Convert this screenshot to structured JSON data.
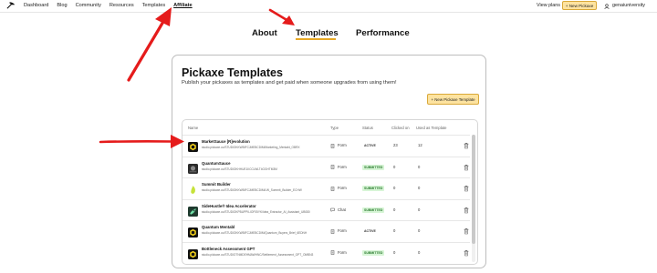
{
  "topnav": {
    "links": [
      "Dashboard",
      "Blog",
      "Community",
      "Resources",
      "Templates",
      "Affiliate"
    ],
    "active": "Affiliate",
    "view_plans": "View plans",
    "new_pickaxe": "+ New Pickaxe",
    "username": "genaiuniversity"
  },
  "tabs": [
    "About",
    "Templates",
    "Performance"
  ],
  "active_tab": "Templates",
  "card": {
    "title": "Pickaxe Templates",
    "subtitle": "Publish your pickaxes as templates and get paid when someone upgrades from using them!",
    "new_template_button": "+ New Pickaxe Template"
  },
  "table": {
    "headers": [
      "Name",
      "Type",
      "Status",
      "Clicked on",
      "Used as Template"
    ],
    "rows": [
      {
        "name": "MarketSauce [R]evolution",
        "url": "studio.pickaxe.co/STUDIOKKWBIFCJMEBCDIM/Marketing_Mentabt_OBRX",
        "type": "Form",
        "status": "ACTIVE",
        "clicked": "23",
        "used": "12",
        "avatar_icon": "hexagon-icon",
        "avatar_color": "#111111"
      },
      {
        "name": "QuantumSauce",
        "url": "studio.pickaxe.co/STUDIOKHHUE1IICCLWLT4GGHTM3M",
        "type": "Form",
        "status": "SUBMITTED",
        "clicked": "0",
        "used": "0",
        "avatar_icon": "photo-icon",
        "avatar_color": "#2b2b2b"
      },
      {
        "name": "Summit Builder",
        "url": "studio.pickaxe.co/STUDIOKKWBIFCJMEBCDIM/LW_Summit_Builder_ECHW",
        "type": "Form",
        "status": "SUBMITTED",
        "clicked": "0",
        "used": "0",
        "avatar_icon": "flame-icon",
        "avatar_color": "#c6e23a"
      },
      {
        "name": "SideHustle® Idea Accelerator",
        "url": "studio.pickaxe.co/STUDIOKPBUPPILIOF05YK/Idea_Extractor_AI_Assistant_UB080",
        "type": "Chat",
        "status": "SUBMITTED",
        "clicked": "0",
        "used": "0",
        "avatar_icon": "rocket-icon",
        "avatar_color": "#1f3a2e"
      },
      {
        "name": "Quantum Mentabl",
        "url": "studio.pickaxe.co/STUDIOKKWBIFCJMEBCDIM/Quantum_Buyers_Brief_6EDNH",
        "type": "Form",
        "status": "ACTIVE",
        "clicked": "0",
        "used": "0",
        "avatar_icon": "hexagon-icon",
        "avatar_color": "#111111"
      },
      {
        "name": "Bottleneck Assessment GPT",
        "url": "studio.pickaxe.co/STUDIOTNMDEHMAWHNC/Settlement_Assessment_GPT_OMBN3",
        "type": "Form",
        "status": "SUBMITTED",
        "clicked": "0",
        "used": "0",
        "avatar_icon": "hexagon-icon",
        "avatar_color": "#111111"
      }
    ]
  },
  "colors": {
    "accent": "#e7a825",
    "button_fill": "#fde3a0",
    "arrow": "#e51b1b",
    "status_submitted_bg": "#d7f5d6",
    "status_submitted_text": "#2e7d32"
  }
}
